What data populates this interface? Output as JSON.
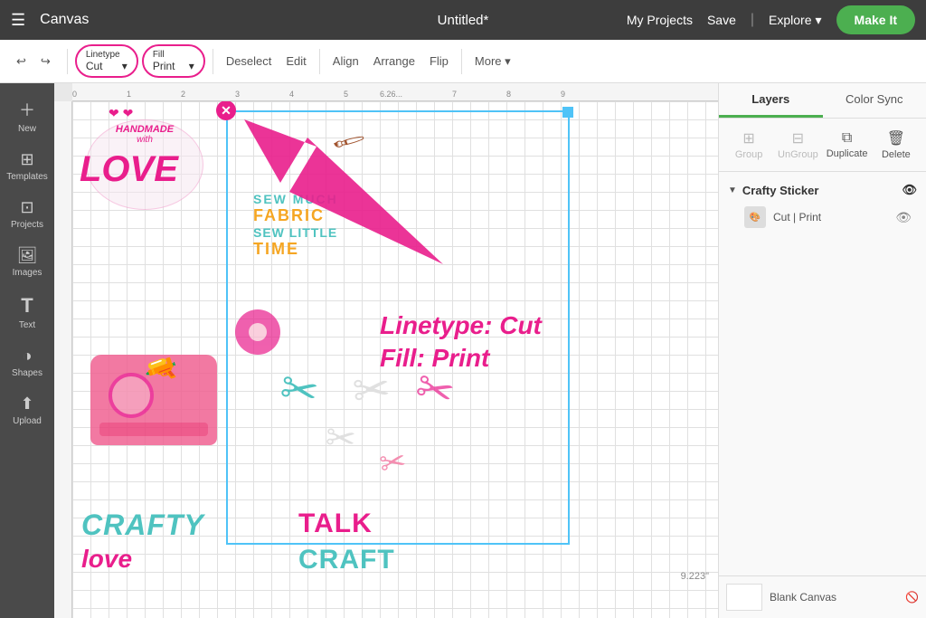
{
  "topNav": {
    "menuIcon": "☰",
    "appTitle": "Canvas",
    "docTitle": "Untitled*",
    "myProjects": "My Projects",
    "save": "Save",
    "divider": "|",
    "explore": "Explore",
    "exploreIcon": "▾",
    "makeIt": "Make It"
  },
  "toolbar": {
    "undo": "↩",
    "redo": "↪",
    "linetypeLabel": "Linetype",
    "linetypeValue": "Cut",
    "fillLabel": "Fill",
    "fillValue": "Print",
    "deselect": "Deselect",
    "edit": "Edit",
    "align": "Align",
    "arrange": "Arrange",
    "flip": "Flip",
    "more": "More ▾"
  },
  "leftSidebar": {
    "items": [
      {
        "icon": "＋",
        "label": "New"
      },
      {
        "icon": "⊞",
        "label": "Templates"
      },
      {
        "icon": "⊡",
        "label": "Projects"
      },
      {
        "icon": "🖼",
        "label": "Images"
      },
      {
        "icon": "T",
        "label": "Text"
      },
      {
        "icon": "◑",
        "label": "Shapes"
      },
      {
        "icon": "⬆",
        "label": "Upload"
      }
    ]
  },
  "annotation": {
    "text1": "Linetype: Cut",
    "text2": "Fill: Print"
  },
  "rightPanel": {
    "tabs": [
      {
        "label": "Layers",
        "active": true
      },
      {
        "label": "Color Sync",
        "active": false
      }
    ],
    "tools": [
      {
        "icon": "⊞",
        "label": "Group",
        "disabled": true
      },
      {
        "icon": "⊟",
        "label": "UnGroup",
        "disabled": true
      },
      {
        "icon": "⧉",
        "label": "Duplicate",
        "disabled": false
      },
      {
        "icon": "🗑",
        "label": "Delete",
        "disabled": false
      }
    ],
    "layerGroup": {
      "name": "Crafty Sticker",
      "visible": true,
      "items": [
        {
          "label": "Cut  |  Print",
          "thumb": "🖼"
        }
      ]
    },
    "bottomStrip": {
      "label": "Blank Canvas",
      "visible": false
    }
  },
  "measurement": {
    "label": "9.223\""
  }
}
